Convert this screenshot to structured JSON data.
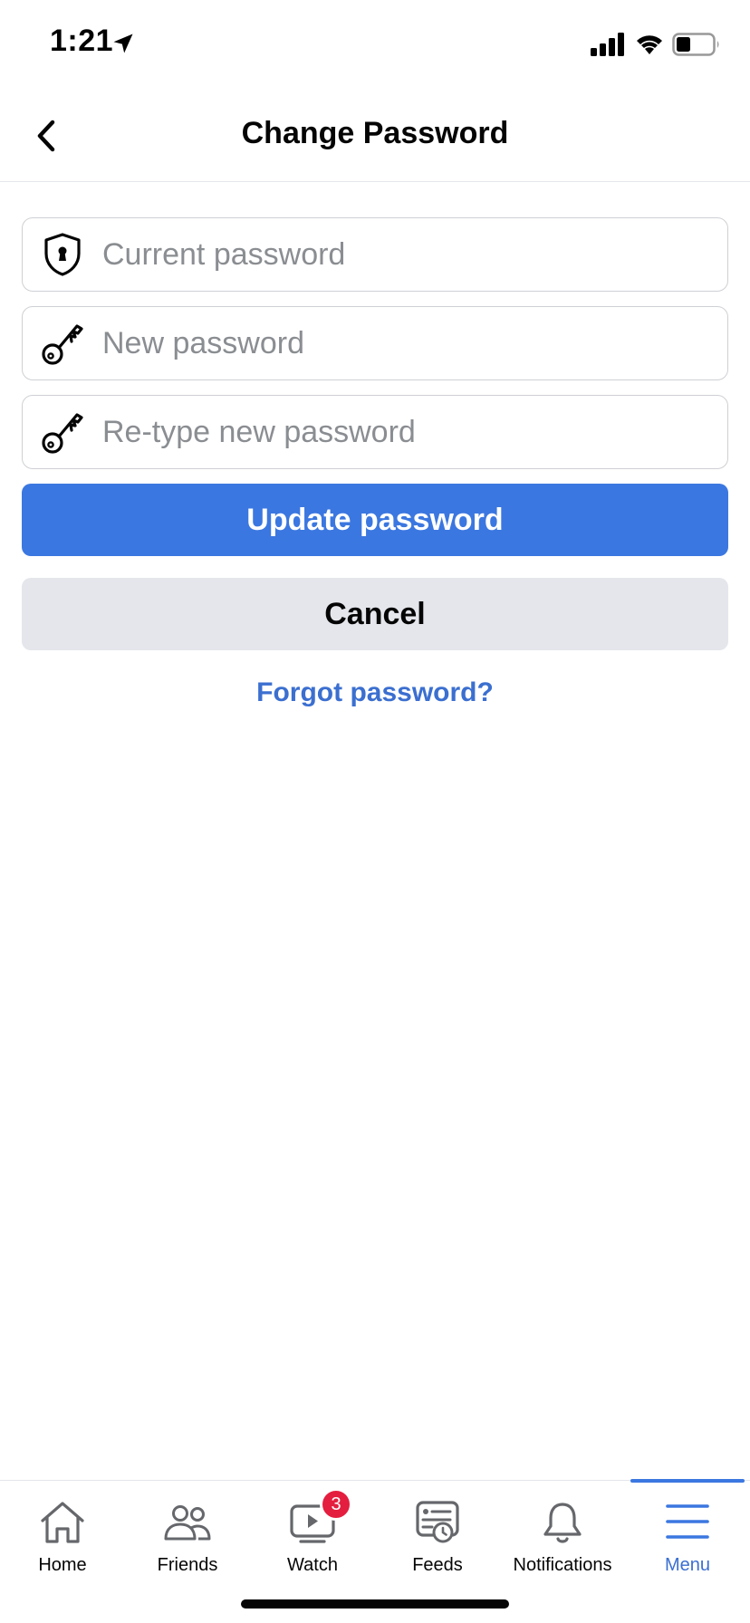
{
  "status_bar": {
    "time": "1:21"
  },
  "header": {
    "title": "Change Password"
  },
  "form": {
    "current_password": {
      "placeholder": "Current password",
      "value": ""
    },
    "new_password": {
      "placeholder": "New password",
      "value": ""
    },
    "retype_password": {
      "placeholder": "Re-type new password",
      "value": ""
    },
    "update_label": "Update password",
    "cancel_label": "Cancel",
    "forgot_label": "Forgot password?"
  },
  "tabs": [
    {
      "label": "Home",
      "icon": "home-icon"
    },
    {
      "label": "Friends",
      "icon": "friends-icon"
    },
    {
      "label": "Watch",
      "icon": "watch-icon",
      "badge": "3"
    },
    {
      "label": "Feeds",
      "icon": "feeds-icon"
    },
    {
      "label": "Notifications",
      "icon": "bell-icon"
    },
    {
      "label": "Menu",
      "icon": "menu-icon",
      "active": true
    }
  ],
  "colors": {
    "accent": "#3b77e0",
    "link": "#3b6fd0",
    "badge": "#e41e3f",
    "secondary_button": "#e4e6eb"
  }
}
